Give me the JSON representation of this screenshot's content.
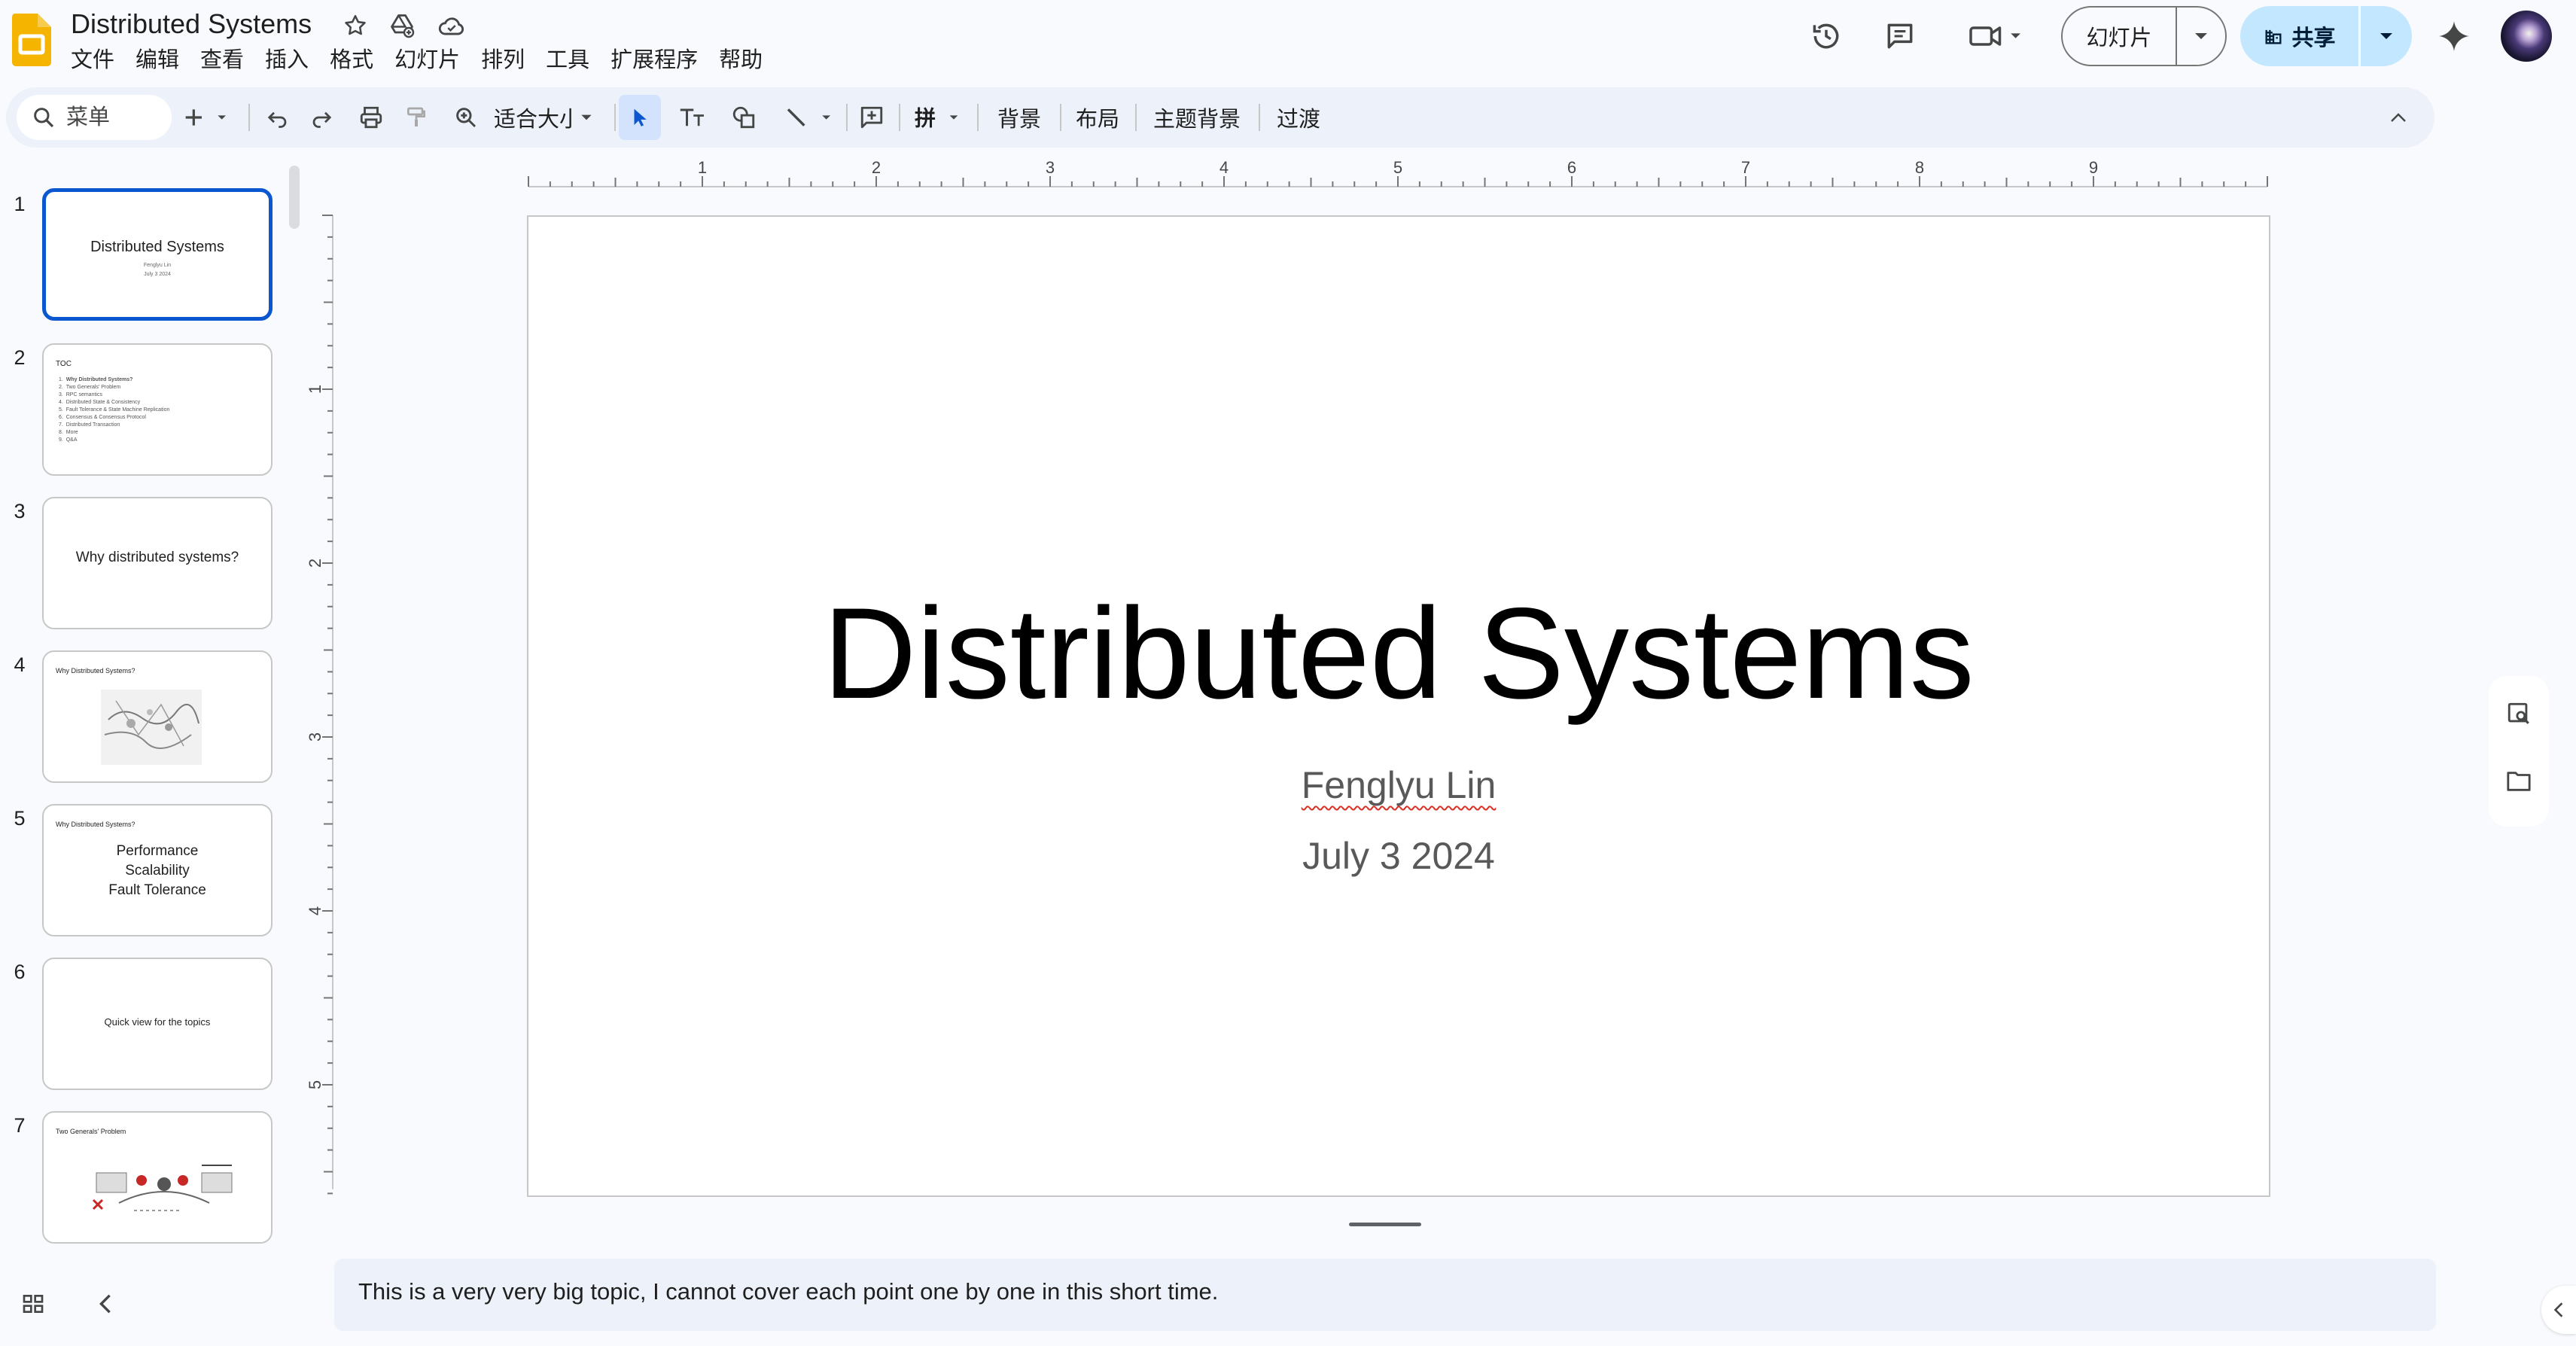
{
  "app": {
    "doc_title": "Distributed Systems",
    "menu": [
      "文件",
      "编辑",
      "查看",
      "插入",
      "格式",
      "幻灯片",
      "排列",
      "工具",
      "扩展程序",
      "帮助"
    ],
    "slideshow_label": "幻灯片",
    "share_label": "共享",
    "icons": [
      "star-icon",
      "move-to-drive-icon",
      "cloud-saved-icon",
      "version-history-icon",
      "comments-icon",
      "meet-icon",
      "gemini-icon"
    ]
  },
  "toolbar": {
    "search_placeholder": "菜单",
    "zoom_label": "适合大小",
    "background_label": "背景",
    "layout_label": "布局",
    "theme_label": "主题背景",
    "transition_label": "过渡"
  },
  "ruler": {
    "h_labels": [
      "1",
      "2",
      "3",
      "4",
      "5",
      "6",
      "7",
      "8",
      "9"
    ],
    "v_labels": [
      "1",
      "2",
      "3",
      "4",
      "5"
    ]
  },
  "slides": [
    {
      "num": "1",
      "title": "Distributed Systems",
      "sub1": "Fenglyu Lin",
      "sub2": "July 3 2024"
    },
    {
      "num": "2",
      "title": "TOC",
      "items": [
        "Why Distributed Systems?",
        "Two Generals' Problem",
        "RPC semantics",
        "Distributed State & Consistency",
        "Fault Tolerance & State Machine Replication",
        "Consensus & Consensus Protocol",
        "Distributed Transaction",
        "More",
        "Q&A"
      ]
    },
    {
      "num": "3",
      "title": "Why distributed systems?"
    },
    {
      "num": "4",
      "title": "Why Distributed Systems?"
    },
    {
      "num": "5",
      "title": "Why Distributed Systems?",
      "lines": [
        "Performance",
        "Scalability",
        "Fault Tolerance"
      ]
    },
    {
      "num": "6",
      "title": "Quick view for the topics"
    },
    {
      "num": "7",
      "title": "Two Generals' Problem"
    }
  ],
  "current_slide": {
    "title": "Distributed Systems",
    "author": "Fenglyu Lin",
    "date": "July 3 2024"
  },
  "speaker_notes": "This is a very very big topic, I cannot cover each point one by one in this short time.",
  "colors": {
    "accent": "#0b57d0",
    "share_bg": "#c2e7ff",
    "toolbar_bg": "#edf2fa",
    "logo": "#f4b400"
  }
}
